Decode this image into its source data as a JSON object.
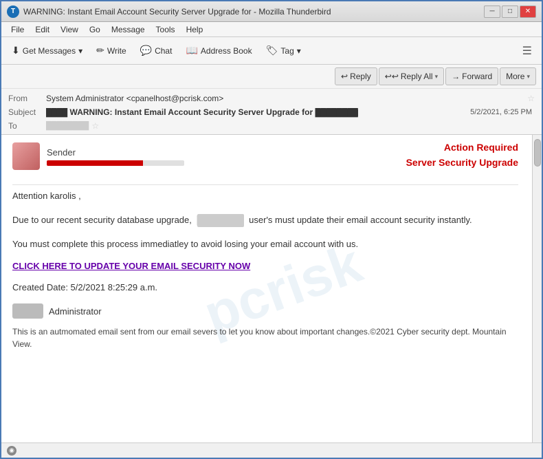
{
  "window": {
    "title": "WARNING: Instant Email Account Security Server Upgrade for  - Mozilla Thunderbird",
    "app_name": "Mozilla Thunderbird",
    "icon_label": "T"
  },
  "menu": {
    "items": [
      "File",
      "Edit",
      "View",
      "Go",
      "Message",
      "Tools",
      "Help"
    ]
  },
  "toolbar": {
    "get_messages_label": "Get Messages",
    "write_label": "Write",
    "chat_label": "Chat",
    "address_book_label": "Address Book",
    "tag_label": "Tag",
    "hamburger_label": "☰"
  },
  "email_actions": {
    "reply_label": "Reply",
    "reply_all_label": "Reply All",
    "forward_label": "Forward",
    "more_label": "More"
  },
  "email_meta": {
    "from_label": "From",
    "from_value": "System Administrator <cpanelhost@pcrisk.com>",
    "subject_label": "Subject",
    "subject_prefix": "WARNING: Instant Email Account Security Server Upgrade for",
    "subject_blurred": "██████████",
    "date": "5/2/2021, 6:25 PM",
    "to_label": "To",
    "to_blurred": "████████"
  },
  "email_body": {
    "sender_label": "Sender",
    "action_required": "Action Required",
    "server_security": "Server Security Upgrade",
    "greeting": "Attention  karolis ,",
    "paragraph1": "Due to our recent security database upgrade,",
    "paragraph1_blurred": "████████",
    "paragraph1_cont": "user's must update their email account security instantly.",
    "paragraph2": "You must complete this process immediatley to avoid losing your email account with us.",
    "link_text": "CLICK HERE TO UPDATE YOUR EMAIL SECURITY NOW",
    "created_date": "Created Date:  5/2/2021 8:25:29 a.m.",
    "admin_text": "Administrator",
    "admin_blurred": "████████",
    "footer": "This is an autmomated email sent from our email severs to let you know about important changes.©2021 Cyber security dept. Mountain View."
  },
  "status_bar": {
    "icon": "◉"
  }
}
